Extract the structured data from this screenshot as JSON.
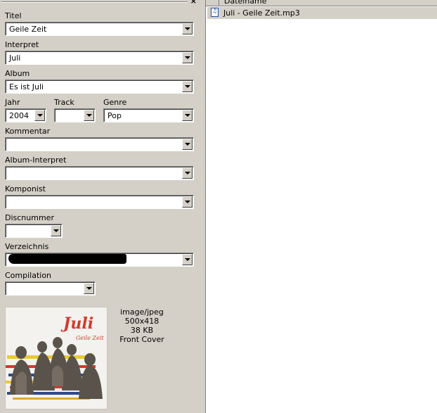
{
  "tag_panel": {
    "close_glyph": "×",
    "fields": {
      "title": {
        "label": "Titel",
        "value": "Geile Zeit"
      },
      "artist": {
        "label": "Interpret",
        "value": "Juli"
      },
      "album": {
        "label": "Album",
        "value": "Es ist Juli"
      },
      "year": {
        "label": "Jahr",
        "value": "2004"
      },
      "track": {
        "label": "Track",
        "value": ""
      },
      "genre": {
        "label": "Genre",
        "value": "Pop"
      },
      "comment": {
        "label": "Kommentar",
        "value": ""
      },
      "album_artist": {
        "label": "Album-Interpret",
        "value": ""
      },
      "composer": {
        "label": "Komponist",
        "value": ""
      },
      "disc_number": {
        "label": "Discnummer",
        "value": ""
      },
      "directory": {
        "label": "Verzeichnis",
        "value": ""
      },
      "compilation": {
        "label": "Compilation",
        "value": ""
      }
    },
    "cover": {
      "mime": "image/jpeg",
      "dimensions": "500x418",
      "size": "38 KB",
      "type": "Front Cover",
      "art_title": "Juli",
      "art_subtitle": "Geile Zeit"
    }
  },
  "file_list": {
    "column_header": "Dateiname",
    "files": [
      {
        "name": "Juli - Geile Zeit.mp3",
        "icon": "audio-file-icon"
      }
    ]
  },
  "colors": {
    "panel_bg": "#d4d0c8",
    "selection_bg": "#d4d0c8",
    "list_bg": "#ffffff",
    "cover_title_red": "#d33a2c"
  }
}
